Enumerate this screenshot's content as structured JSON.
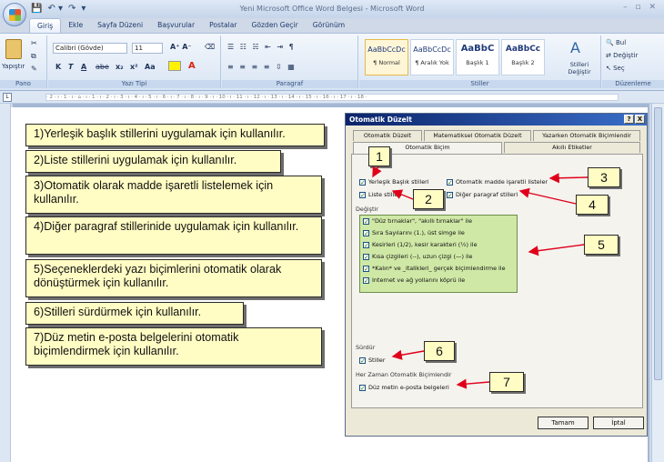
{
  "window": {
    "title": "Yeni Microsoft Office Word Belgesi - Microsoft Word",
    "controls": "– ▫ ✕"
  },
  "qat": {
    "save": "💾",
    "undo": "↶ ▾",
    "redo": "↷",
    "more": "▾"
  },
  "tabs": [
    "Giriş",
    "Ekle",
    "Sayfa Düzeni",
    "Başvurular",
    "Postalar",
    "Gözden Geçir",
    "Görünüm"
  ],
  "ribbon": {
    "paste_label": "Yapıştır",
    "font_name": "Calibri (Gövde)",
    "font_size": "11",
    "groups": {
      "clipboard": "Pano",
      "font": "Yazı Tipi",
      "paragraph": "Paragraf",
      "styles": "Stiller",
      "editing": "Düzenleme"
    },
    "format_buttons": [
      "K",
      "T",
      "A",
      "abe",
      "x₂",
      "x²",
      "Aa"
    ],
    "styles": [
      {
        "preview": "AaBbCcDc",
        "name": "¶ Normal"
      },
      {
        "preview": "AaBbCcDc",
        "name": "¶ Aralık Yok"
      },
      {
        "preview": "AaBbC",
        "name": "Başlık 1"
      },
      {
        "preview": "AaBbCc",
        "name": "Başlık 2"
      }
    ],
    "change_styles": "Stilleri Değiştir",
    "find": "Bul",
    "replace": "Değiştir",
    "select": "Seç"
  },
  "ruler": {
    "scale": "· 2 · ı · 1 · ı · ⌂ · ı · 1 · ı · 2 · ı · 3 · ı · 4 · ı · 5 · ı · 6 · ı · 7 · ı · 8 · ı · 9 · ı · 10 · ı · 11 · ı · 12 · ı · 13 · ı · 14 · ı · 15 · ı · 16 · ı · 17 · ı · 18 ·"
  },
  "callouts": [
    "1)Yerleşik başlık stillerini uygulamak için kullanılır.",
    "2)Liste stillerini uygulamak için kullanılır.",
    "3)Otomatik olarak madde işaretli listelemek için kullanılır.",
    "4)Diğer paragraf stillerinide uygulamak için kullanılır.",
    "5)Seçeneklerdeki yazı biçimlerini otomatik olarak dönüştürmek için kullanılır.",
    "6)Stilleri sürdürmek için kullanılır.",
    "7)Düz metin e-posta belgelerini otomatik biçimlendirmek için kullanılır."
  ],
  "dialog": {
    "title": "Otomatik Düzelt",
    "help": "?",
    "close": "X",
    "tabs_row1": [
      "Otomatik Düzelt",
      "Matematiksel Otomatik Düzelt",
      "Yazarken Otomatik Biçimlendir"
    ],
    "tabs_row2": [
      "Otomatik Biçim",
      "Akıllı Etiketler"
    ],
    "apply_options": [
      {
        "label": "Yerleşik Başlık stilleri",
        "checked": true
      },
      {
        "label": "Otomatik madde işaretli listeler",
        "checked": true
      },
      {
        "label": "Liste stilleri",
        "checked": true
      },
      {
        "label": "Diğer paragraf stilleri",
        "checked": true
      }
    ],
    "replace_label": "Değiştir",
    "replace_options": [
      {
        "label": "\"Düz tırnaklar\", \"akıllı tırnaklar\" ile",
        "checked": true
      },
      {
        "label": "Sıra Sayılarını (1.), üst simge ile",
        "checked": true
      },
      {
        "label": "Kesirleri (1/2), kesir karakteri (½) ile",
        "checked": true
      },
      {
        "label": "Kısa çizgileri (--), uzun çizgi (—) ile",
        "checked": true
      },
      {
        "label": "*Kalın* ve _italikleri_ gerçek biçimlendirme ile",
        "checked": true
      },
      {
        "label": "Internet ve ağ yollarını köprü ile",
        "checked": true
      }
    ],
    "preserve_label": "Sürdür",
    "preserve_option": {
      "label": "Stiller",
      "checked": true
    },
    "always_label": "Her Zaman Otomatik Biçimlendir",
    "always_option": {
      "label": "Düz metin e-posta belgeleri",
      "checked": true
    },
    "ok": "Tamam",
    "cancel": "İptal"
  },
  "markers": [
    "1",
    "2",
    "3",
    "4",
    "5",
    "6",
    "7"
  ],
  "colors": {
    "callout_bg": "#fffcc4",
    "highlight": "#cfe8a6",
    "arrow": "#e0001a",
    "titlebar": "#0b246a"
  }
}
